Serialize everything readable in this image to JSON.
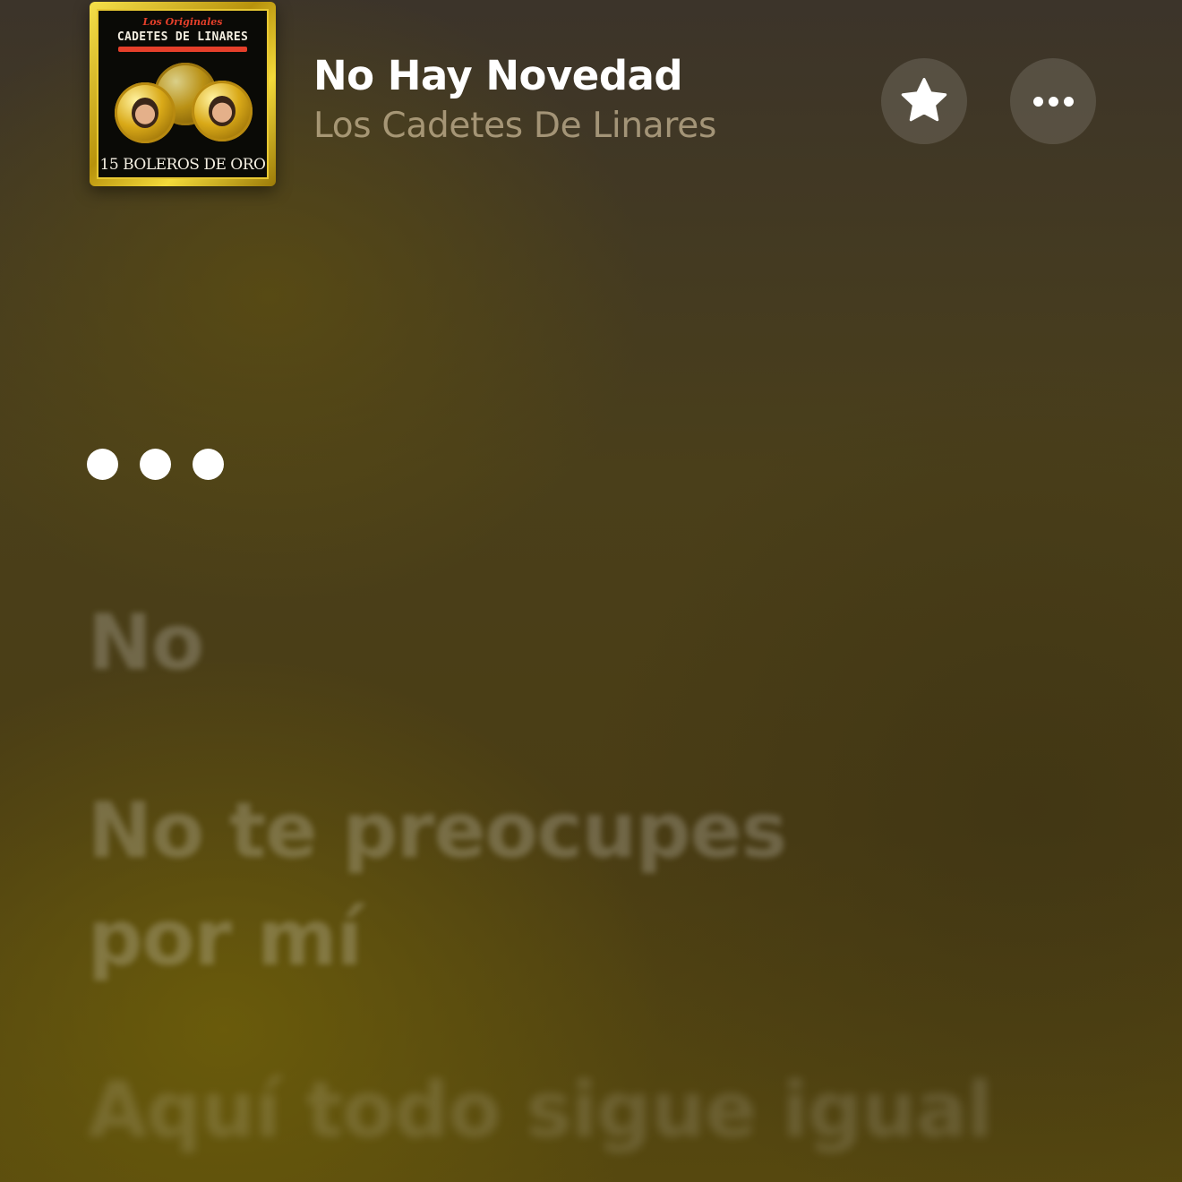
{
  "album": {
    "art_top_text": "Los Originales",
    "art_title": "CADETES DE LINARES",
    "art_bottom_text": "15 BOLEROS DE ORO",
    "colors": {
      "frame": "#d9b21c",
      "red": "#e53f2a"
    }
  },
  "track": {
    "title": "No Hay Novedad",
    "artist": "Los Cadetes De Linares"
  },
  "actions": {
    "favorite_icon": "star-icon",
    "more_icon": "ellipsis-icon"
  },
  "lyrics": {
    "current_indicator": "ellipsis",
    "lines": [
      "No",
      "No te preocupes\npor mí",
      "Aquí todo sigue igual"
    ]
  }
}
